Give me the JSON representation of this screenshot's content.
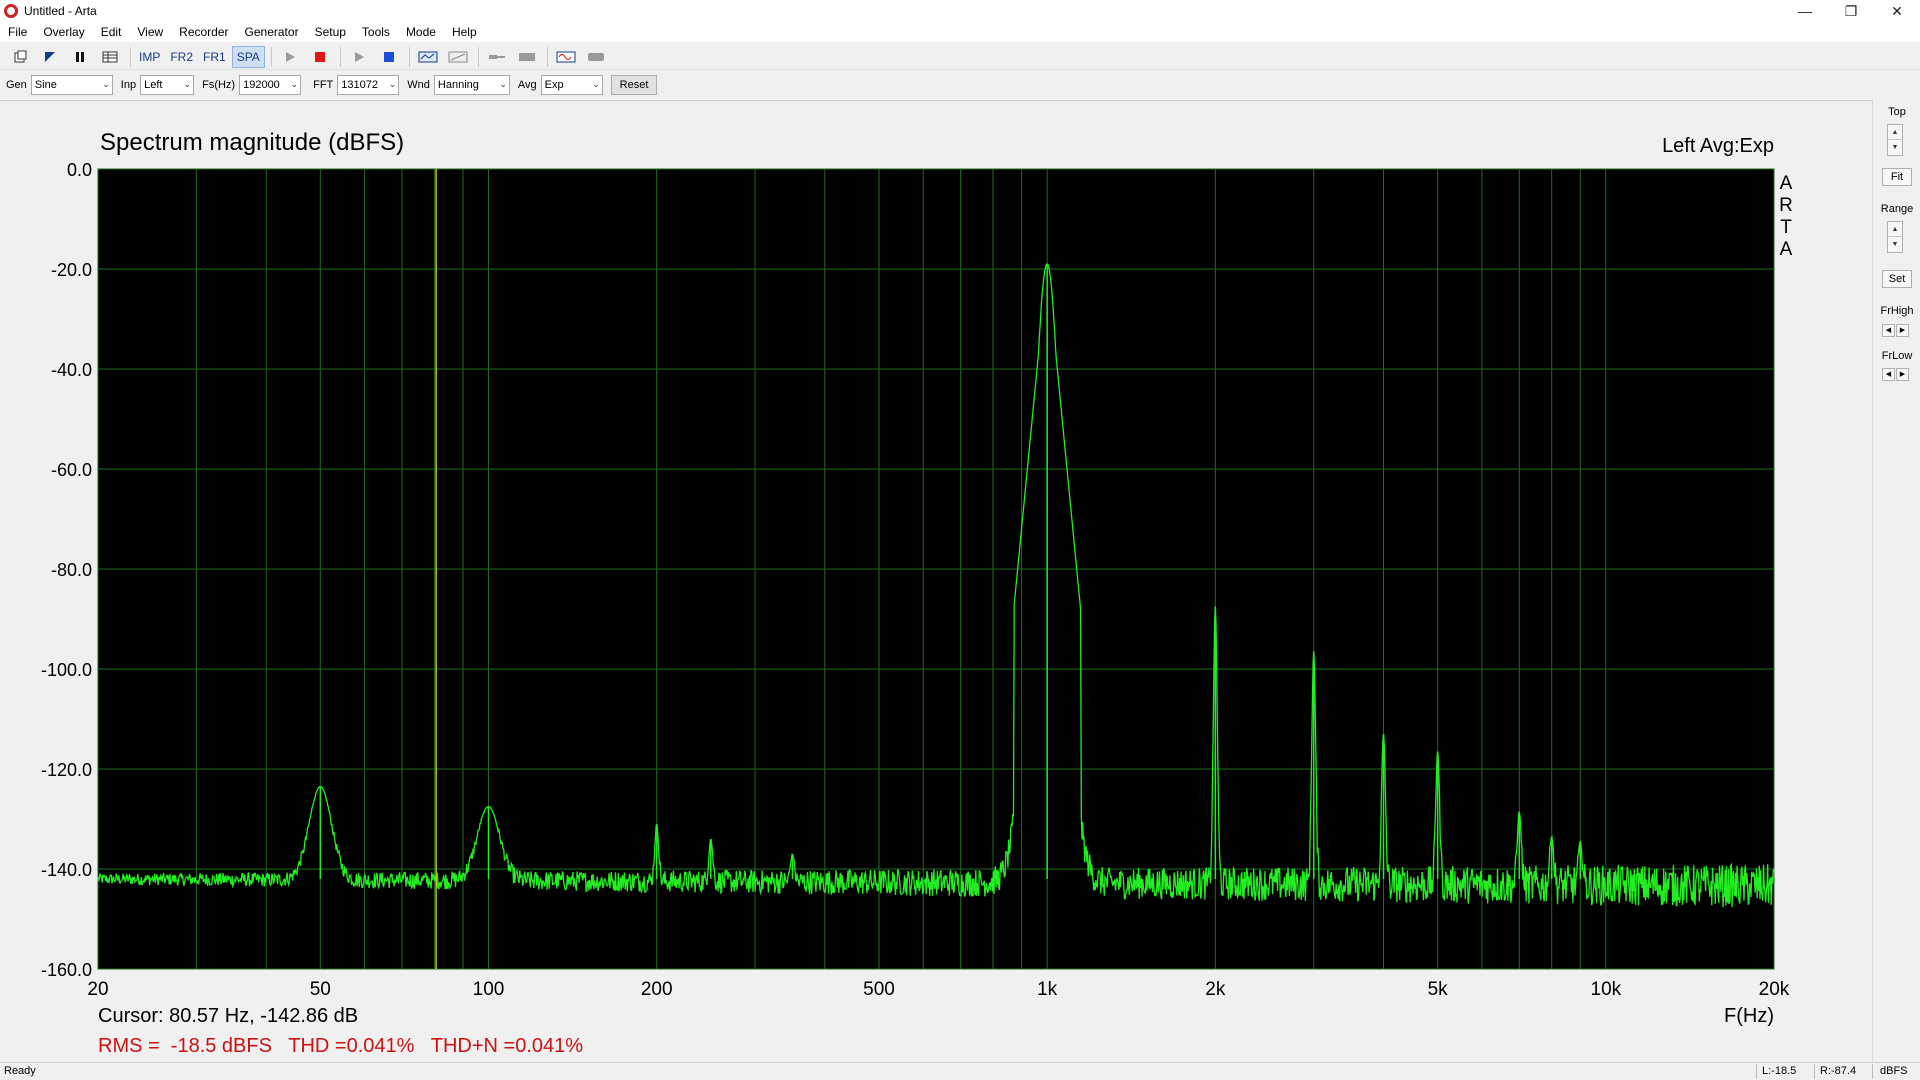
{
  "window": {
    "title": "Untitled - Arta"
  },
  "menu": [
    "File",
    "Overlay",
    "Edit",
    "View",
    "Recorder",
    "Generator",
    "Setup",
    "Tools",
    "Mode",
    "Help"
  ],
  "toolbar": {
    "imp": "IMP",
    "fr2": "FR2",
    "fr1": "FR1",
    "spa": "SPA"
  },
  "controls": {
    "gen_label": "Gen",
    "gen_value": "Sine",
    "inp_label": "Inp",
    "inp_value": "Left",
    "fs_label": "Fs(Hz)",
    "fs_value": "192000",
    "fft_label": "FFT",
    "fft_value": "131072",
    "wnd_label": "Wnd",
    "wnd_value": "Hanning",
    "avg_label": "Avg",
    "avg_value": "Exp",
    "reset_label": "Reset"
  },
  "plot": {
    "channel_info": "Left  Avg:Exp",
    "watermark": [
      "A",
      "R",
      "T",
      "A"
    ],
    "cursor_readout": "Cursor: 80.57 Hz, -142.86 dB",
    "measurement": "RMS =  -18.5 dBFS   THD =0.041%   THD+N =0.041%",
    "colors": {
      "background": "#000000",
      "grid": "#1f6b1f",
      "trace": "#22ee22",
      "cursor": "#c8c800",
      "measurement": "#cc1111"
    }
  },
  "chart_data": {
    "type": "line",
    "title": "Spectrum magnitude (dBFS)",
    "xlabel": "F(Hz)",
    "ylabel": "",
    "x_scale": "log",
    "xlim": [
      20,
      20000
    ],
    "ylim": [
      -160,
      0
    ],
    "x_ticks": [
      20,
      50,
      100,
      200,
      500,
      1000,
      2000,
      5000,
      10000,
      20000
    ],
    "x_tick_labels": [
      "20",
      "50",
      "100",
      "200",
      "500",
      "1k",
      "2k",
      "5k",
      "10k",
      "20k"
    ],
    "y_ticks": [
      0,
      -20,
      -40,
      -60,
      -80,
      -100,
      -120,
      -140,
      -160
    ],
    "y_tick_labels": [
      "0.0",
      "-20.0",
      "-40.0",
      "-60.0",
      "-80.0",
      "-100.0",
      "-120.0",
      "-140.0",
      "-160.0"
    ],
    "grid": true,
    "cursor_x": 80.57,
    "noise_floor": -142,
    "peaks": [
      {
        "x": 50,
        "y": -123.5
      },
      {
        "x": 100,
        "y": -127.5
      },
      {
        "x": 200,
        "y": -131
      },
      {
        "x": 250,
        "y": -134
      },
      {
        "x": 350,
        "y": -137
      },
      {
        "x": 1000,
        "y": -19
      },
      {
        "x": 2000,
        "y": -87.5
      },
      {
        "x": 3000,
        "y": -96.5
      },
      {
        "x": 4000,
        "y": -113
      },
      {
        "x": 5000,
        "y": -116.5
      },
      {
        "x": 7000,
        "y": -128.5
      },
      {
        "x": 8000,
        "y": -133.5
      },
      {
        "x": 9000,
        "y": -134.5
      }
    ]
  },
  "right_panel": {
    "top_label": "Top",
    "fit_label": "Fit",
    "range_label": "Range",
    "set_label": "Set",
    "frhigh_label": "FrHigh",
    "frlow_label": "FrLow"
  },
  "status": {
    "ready": "Ready",
    "left_level": "L:-18.5",
    "right_level": "R:-87.4",
    "unit": "dBFS"
  }
}
